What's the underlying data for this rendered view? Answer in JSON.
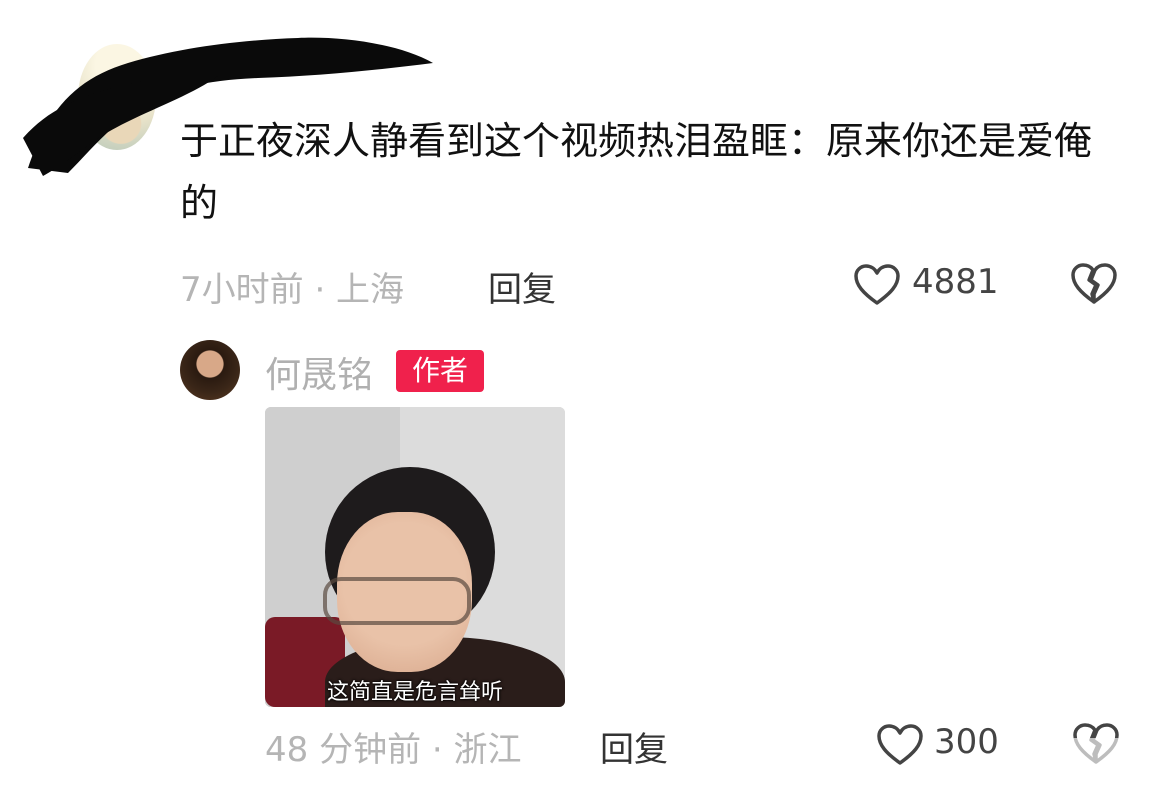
{
  "comment": {
    "text": "于正夜深人静看到这个视频热泪盈眶：原来你还是爱俺的",
    "time_location": "7小时前 · 上海",
    "reply_label": "回复",
    "likes": "4881",
    "icons": {
      "like": "heart-outline-icon",
      "dislike": "broken-heart-icon"
    }
  },
  "reply": {
    "author": "何晟铭",
    "author_badge": "作者",
    "badge_color": "#f0214c",
    "image_caption": "这简直是危言耸听",
    "time_location": "48 分钟前 · 浙江",
    "reply_label": "回复",
    "likes": "300",
    "icons": {
      "like": "heart-outline-icon",
      "dislike": "broken-heart-icon"
    }
  }
}
